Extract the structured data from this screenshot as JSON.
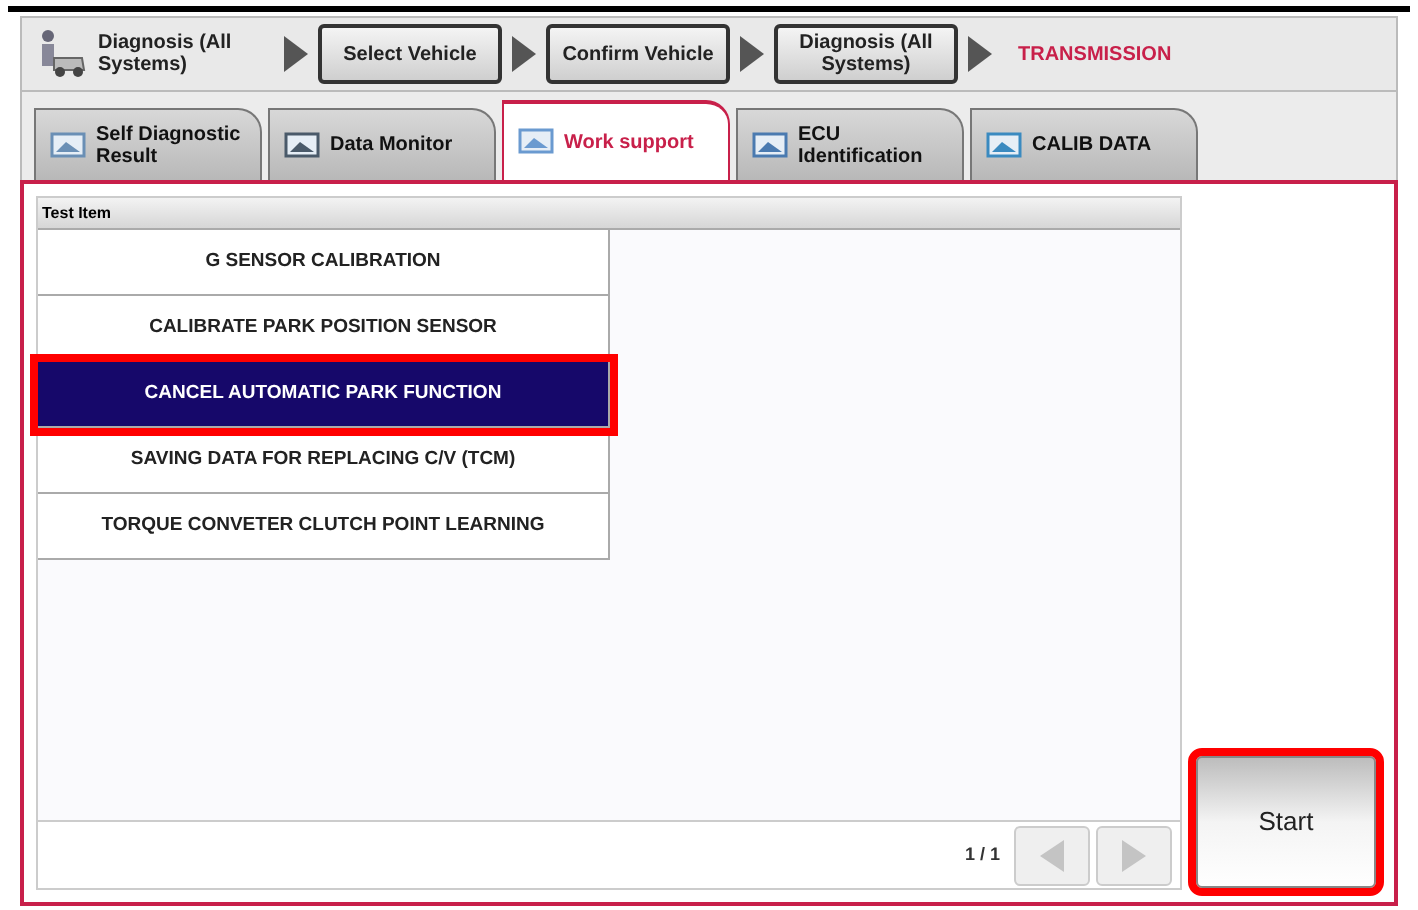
{
  "breadcrumb": [
    {
      "kind": "home",
      "label": "Diagnosis (All Systems)"
    },
    {
      "kind": "button",
      "label": "Select Vehicle"
    },
    {
      "kind": "button",
      "label": "Confirm Vehicle"
    },
    {
      "kind": "button",
      "label": "Diagnosis (All Systems)"
    },
    {
      "kind": "current",
      "label": "TRANSMISSION"
    }
  ],
  "tabs": [
    {
      "label": "Self Diagnostic Result",
      "selected": false
    },
    {
      "label": "Data Monitor",
      "selected": false
    },
    {
      "label": "Work support",
      "selected": true
    },
    {
      "label": "ECU Identification",
      "selected": false
    },
    {
      "label": "CALIB DATA",
      "selected": false
    }
  ],
  "table": {
    "columns": [
      "Test Item"
    ],
    "rows": [
      {
        "label": "G SENSOR CALIBRATION",
        "selected": false,
        "highlighted": false
      },
      {
        "label": "CALIBRATE PARK POSITION SENSOR",
        "selected": false,
        "highlighted": false
      },
      {
        "label": "CANCEL AUTOMATIC PARK FUNCTION",
        "selected": true,
        "highlighted": true
      },
      {
        "label": "SAVING DATA FOR REPLACING C/V (TCM)",
        "selected": false,
        "highlighted": false
      },
      {
        "label": "TORQUE CONVETER CLUTCH POINT LEARNING",
        "selected": false,
        "highlighted": false
      }
    ]
  },
  "pager": {
    "page": "1 / 1",
    "prev_disabled": true,
    "next_disabled": true
  },
  "start_button": {
    "label": "Start",
    "highlighted": true
  }
}
